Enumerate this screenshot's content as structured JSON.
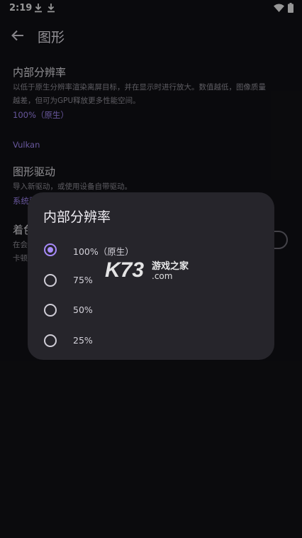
{
  "status": {
    "time": "2:19"
  },
  "app_bar": {
    "title": "图形"
  },
  "settings": {
    "resolution": {
      "title": "内部分辨率",
      "desc_line1": "以低于原生分辨率渲染离屏目标，并在显示时进行放大。数值越低，图像质量",
      "desc_line2": "越差，但可为GPU释放更多性能空间。",
      "value": "100%（原生）"
    },
    "vulkan_header": "Vulkan",
    "driver": {
      "title": "图形驱动",
      "desc": "导入新驱动，或使用设备自带驱动。",
      "value": "系统驱"
    },
    "shader": {
      "title": "着色",
      "desc_line1": "在会",
      "desc_line2": "卡顿"
    }
  },
  "dialog": {
    "title": "内部分辨率",
    "options": [
      {
        "label": "100%（原生）",
        "selected": true
      },
      {
        "label": "75%",
        "selected": false
      },
      {
        "label": "50%",
        "selected": false
      },
      {
        "label": "25%",
        "selected": false
      }
    ]
  },
  "watermark": {
    "logo": "K73",
    "site": "游戏之家",
    "domain": ".com"
  },
  "colors": {
    "accent": "#a78bfa",
    "background": "#111115",
    "dialog": "#26252b"
  }
}
